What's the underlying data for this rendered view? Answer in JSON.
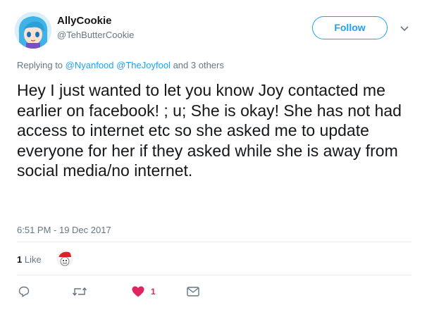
{
  "author": {
    "display_name": "AllyCookie",
    "handle": "@TehButterCookie",
    "avatar_icon": "anime-avatar-blue-hair"
  },
  "follow_label": "Follow",
  "caret_icon": "chevron-down-icon",
  "reply": {
    "prefix": "Replying to",
    "mention_1": "@Nyanfood",
    "mention_2": "@TheJoyfool",
    "suffix": "and 3 others"
  },
  "tweet_text": "Hey I just wanted to let you know Joy contacted me earlier on facebook! ; u; She is okay! She has not had access to internet etc so she asked me to update everyone for her if they asked while she is away from social media/no internet.",
  "timestamp": "6:51 PM - 19 Dec 2017",
  "likes": {
    "count": "1",
    "label": "Like"
  },
  "actions": {
    "reply_icon": "reply-icon",
    "retweet_icon": "retweet-icon",
    "like_icon": "heart-icon",
    "like_count": "1",
    "dm_icon": "envelope-icon"
  },
  "colors": {
    "accent": "#1da1f2",
    "like": "#e0245e",
    "secondary_text": "#657786",
    "divider": "#e6ecf0"
  }
}
